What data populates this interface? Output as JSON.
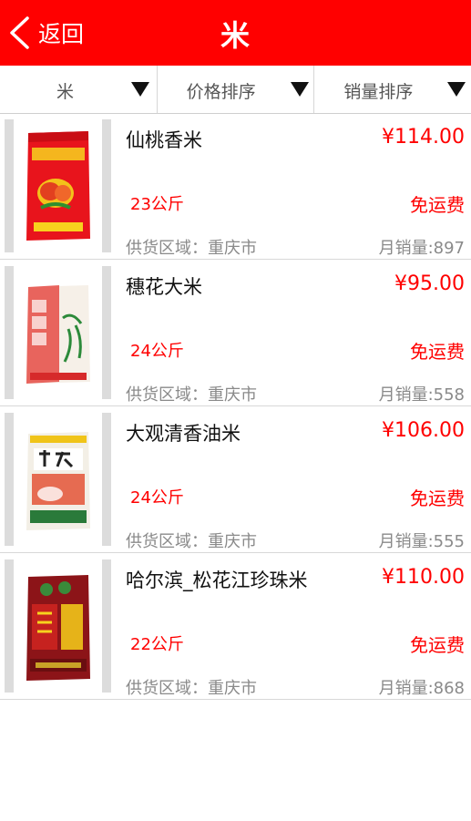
{
  "header": {
    "back_label": "返回",
    "title": "米",
    "bg_color": "#ff0000"
  },
  "filters": [
    {
      "label": "米",
      "icon": "triangle-down-icon"
    },
    {
      "label": "价格排序",
      "icon": "triangle-down-icon"
    },
    {
      "label": "销量排序",
      "icon": "triangle-down-icon"
    }
  ],
  "products": [
    {
      "name": "仙桃香米",
      "price": "¥114.00",
      "weight": "23公斤",
      "shipping": "免运费",
      "region": "供货区域：重庆市",
      "sales": "月销量:897",
      "image": "rice-bag-red"
    },
    {
      "name": "穗花大米",
      "price": "¥95.00",
      "weight": "24公斤",
      "shipping": "免运费",
      "region": "供货区域：重庆市",
      "sales": "月销量:558",
      "image": "rice-bag-white-red"
    },
    {
      "name": "大观清香油米",
      "price": "¥106.00",
      "weight": "24公斤",
      "shipping": "免运费",
      "region": "供货区域：重庆市",
      "sales": "月销量:555",
      "image": "rice-bag-woven"
    },
    {
      "name": "哈尔滨_松花江珍珠米",
      "price": "¥110.00",
      "weight": "22公斤",
      "shipping": "免运费",
      "region": "供货区域：重庆市",
      "sales": "月销量:868",
      "image": "rice-bag-dark-red"
    }
  ],
  "accent_color": "#ff0000"
}
